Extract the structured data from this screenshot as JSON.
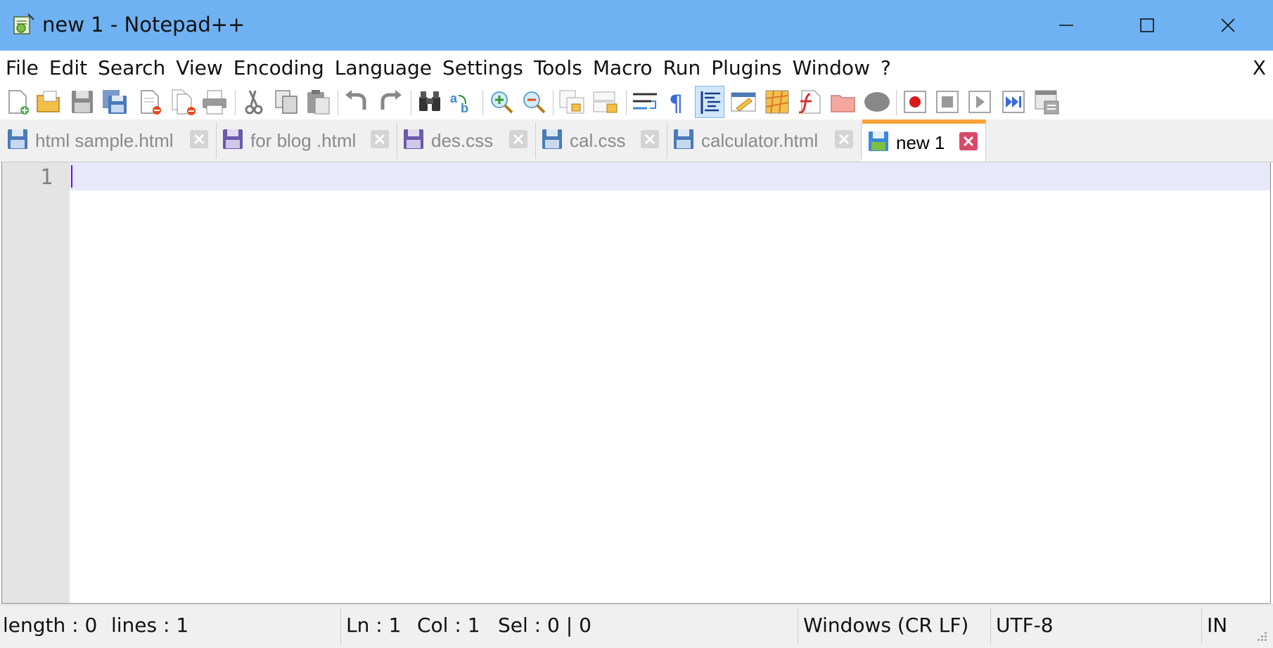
{
  "window": {
    "title": "new 1 - Notepad++"
  },
  "menubar": {
    "items": [
      "File",
      "Edit",
      "Search",
      "View",
      "Encoding",
      "Language",
      "Settings",
      "Tools",
      "Macro",
      "Run",
      "Plugins",
      "Window",
      "?"
    ],
    "close_label": "X"
  },
  "toolbar": {
    "icons": [
      "new-file-icon",
      "open-file-icon",
      "save-icon",
      "save-all-icon",
      "close-icon",
      "close-all-icon",
      "print-icon",
      "cut-icon",
      "copy-icon",
      "paste-icon",
      "undo-icon",
      "redo-icon",
      "find-icon",
      "replace-icon",
      "zoom-in-icon",
      "zoom-out-icon",
      "sync-vertical-icon",
      "sync-horizontal-icon",
      "word-wrap-icon",
      "show-all-characters-icon",
      "indent-guide-icon",
      "user-defined-language-icon",
      "document-map-icon",
      "function-list-icon",
      "folder-as-workspace-icon",
      "monitoring-icon",
      "record-macro-icon",
      "stop-recording-icon",
      "playback-macro-icon",
      "run-macro-multiple-icon",
      "save-macro-icon"
    ]
  },
  "tabs": [
    {
      "label": "html sample.html",
      "state": "inactive"
    },
    {
      "label": "for blog .html",
      "state": "inactive"
    },
    {
      "label": "des.css",
      "state": "inactive"
    },
    {
      "label": "cal.css",
      "state": "inactive"
    },
    {
      "label": "calculator.html",
      "state": "inactive"
    },
    {
      "label": "new 1",
      "state": "active"
    }
  ],
  "editor": {
    "line_numbers": [
      "1"
    ],
    "content": ""
  },
  "statusbar": {
    "length": "length : 0",
    "lines": "lines : 1",
    "ln": "Ln : 1",
    "col": "Col : 1",
    "sel": "Sel : 0 | 0",
    "eol": "Windows (CR LF)",
    "encoding": "UTF-8",
    "mode": "IN"
  },
  "colors": {
    "titlebar": "#6fb2f3",
    "active_tab_accent": "#f6a33b",
    "current_line": "#e8e8fb",
    "gutter": "#e4e4e4"
  }
}
